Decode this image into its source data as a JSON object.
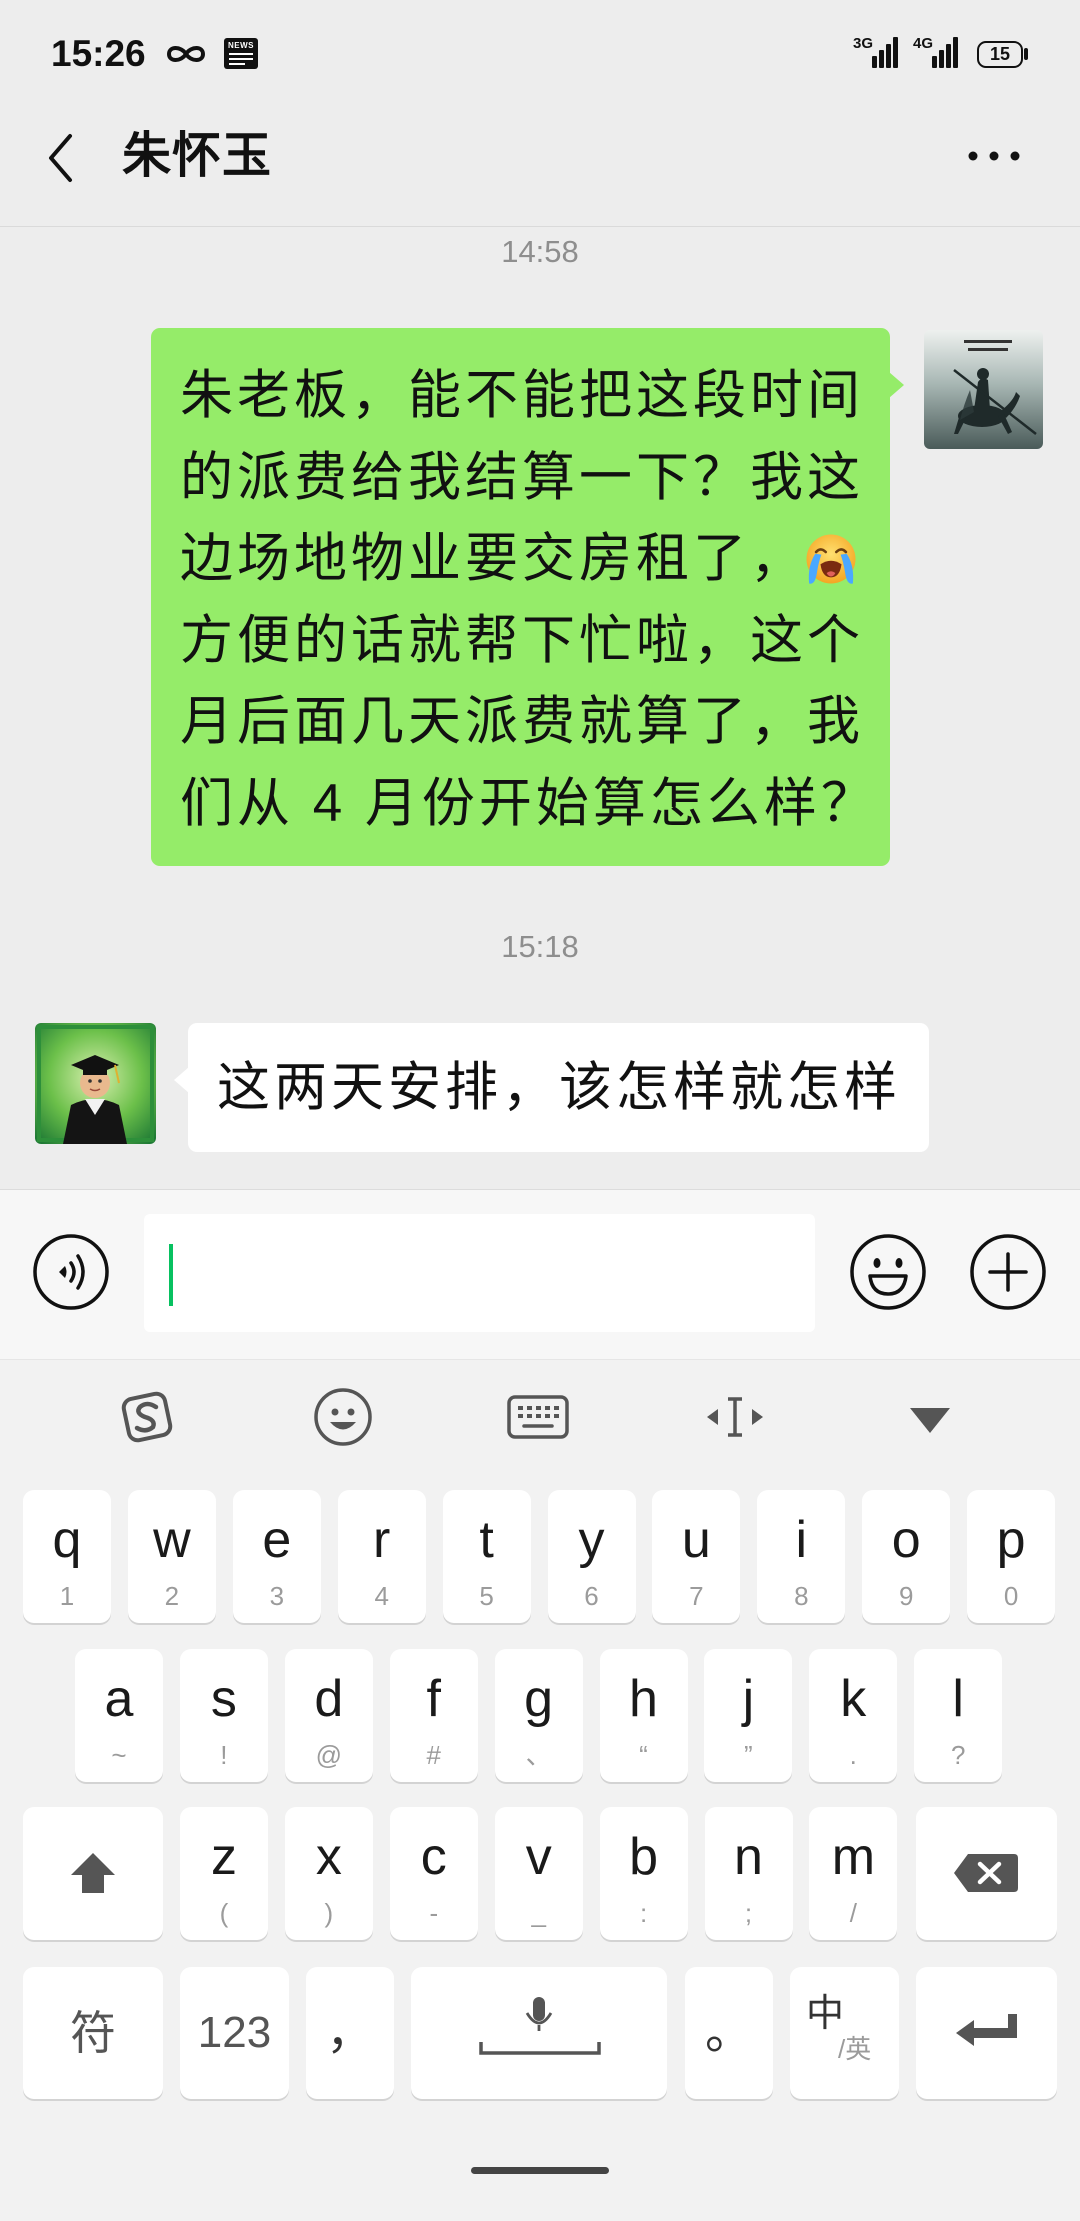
{
  "status_bar": {
    "time": "15:26",
    "infinity_icon": "infinity-icon",
    "news_icon_text": "NEWS",
    "network_1": "3G",
    "network_2": "4G",
    "battery_level": "15"
  },
  "header": {
    "back_icon": "chevron-left-icon",
    "title": "朱怀玉",
    "more_icon": "more-dots-icon"
  },
  "chat": {
    "timestamp_1": "14:58",
    "sent_message": {
      "lines": [
        "朱老板，能不能把这段时间",
        "的派费给我结算一下？我这",
        "边场地物业要交房租了，",
        "方便的话就帮下忙啦，这个",
        "月后面几天派费就算了，我",
        "们从 4 月份开始算怎么样？"
      ],
      "emoji_icon": "loudly-crying-face-icon",
      "bubble_color": "#95ec69"
    },
    "timestamp_2": "15:18",
    "received_message": {
      "text": "这两天安排，该怎样就怎样",
      "bubble_color": "#ffffff"
    }
  },
  "input_bar": {
    "voice_icon": "voice-icon",
    "input_value": "",
    "emoji_icon": "emoji-icon",
    "plus_icon": "plus-icon",
    "accent_color": "#07c160"
  },
  "keyboard": {
    "toolbar_icons": [
      "sogou-logo-icon",
      "emoji-icon",
      "keyboard-icon",
      "cursor-move-icon",
      "collapse-keyboard-icon"
    ],
    "row1": [
      {
        "key": "q",
        "sub": "1"
      },
      {
        "key": "w",
        "sub": "2"
      },
      {
        "key": "e",
        "sub": "3"
      },
      {
        "key": "r",
        "sub": "4"
      },
      {
        "key": "t",
        "sub": "5"
      },
      {
        "key": "y",
        "sub": "6"
      },
      {
        "key": "u",
        "sub": "7"
      },
      {
        "key": "i",
        "sub": "8"
      },
      {
        "key": "o",
        "sub": "9"
      },
      {
        "key": "p",
        "sub": "0"
      }
    ],
    "row2": [
      {
        "key": "a",
        "sub": "~"
      },
      {
        "key": "s",
        "sub": "!"
      },
      {
        "key": "d",
        "sub": "@"
      },
      {
        "key": "f",
        "sub": "#"
      },
      {
        "key": "g",
        "sub": "、"
      },
      {
        "key": "h",
        "sub": "“"
      },
      {
        "key": "j",
        "sub": "”"
      },
      {
        "key": "k",
        "sub": "."
      },
      {
        "key": "l",
        "sub": "?"
      }
    ],
    "row3": [
      {
        "key": "z",
        "sub": "("
      },
      {
        "key": "x",
        "sub": ")"
      },
      {
        "key": "c",
        "sub": "-"
      },
      {
        "key": "v",
        "sub": "_"
      },
      {
        "key": "b",
        "sub": ":"
      },
      {
        "key": "n",
        "sub": ";"
      },
      {
        "key": "m",
        "sub": "/"
      }
    ],
    "shift_icon": "shift-arrow-icon",
    "backspace_icon": "backspace-icon",
    "row4": {
      "symbol": "符",
      "numeric": "123",
      "comma": "，",
      "space_icon": "microphone-icon",
      "period": "。",
      "lang_main": "中",
      "lang_sub": "/英",
      "enter_icon": "enter-icon"
    }
  }
}
